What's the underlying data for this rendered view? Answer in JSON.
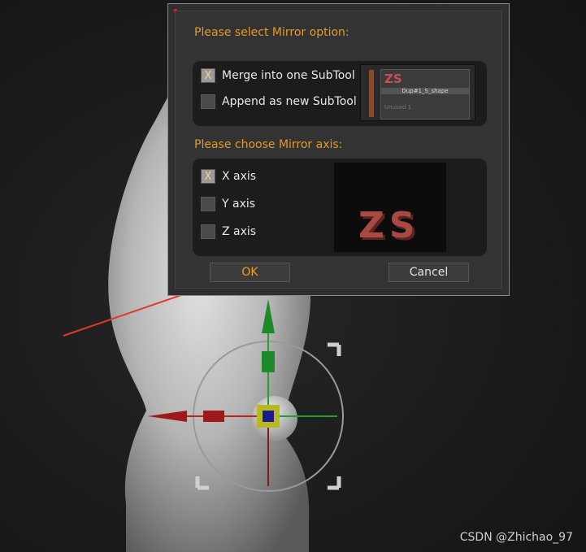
{
  "dialog": {
    "mirror_option_heading": "Please select Mirror option:",
    "mirror_axis_heading": "Please choose Mirror axis:",
    "options": [
      {
        "label": "Merge into one SubTool",
        "checked": true,
        "mark": "X"
      },
      {
        "label": "Append as new SubTool",
        "checked": false,
        "mark": ""
      }
    ],
    "axes": [
      {
        "label": "X axis",
        "checked": true,
        "mark": "X"
      },
      {
        "label": "Y axis",
        "checked": false,
        "mark": ""
      },
      {
        "label": "Z axis",
        "checked": false,
        "mark": ""
      }
    ],
    "subtool_preview": {
      "logo_text": "ZS",
      "name": "Dup#1_S_shape",
      "unused": "Unused 1"
    },
    "axis_preview_text": "ZS",
    "ok_label": "OK",
    "cancel_label": "Cancel"
  },
  "watermark": "CSDN @Zhichao_97",
  "colors": {
    "heading": "#e39a27",
    "ok_text": "#f0a020",
    "arrow": "#e03a2a"
  }
}
